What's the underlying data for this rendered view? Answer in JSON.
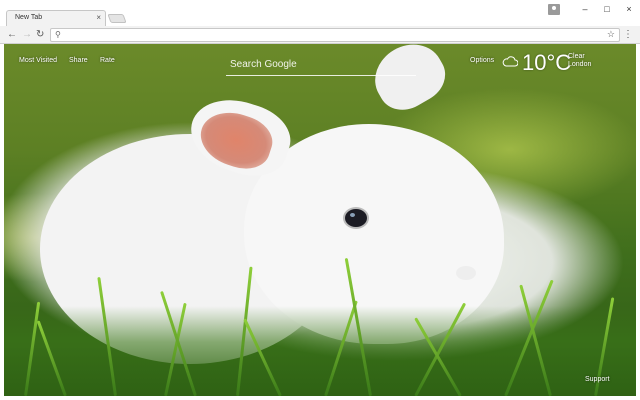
{
  "browser": {
    "tab_title": "New Tab",
    "tab_close": "×",
    "omnibox_value": "",
    "controls": {
      "minimize": "–",
      "maximize": "□",
      "close": "×"
    }
  },
  "page": {
    "nav": {
      "most_visited": "Most Visited",
      "share": "Share",
      "rate": "Rate"
    },
    "search": {
      "placeholder": "Search Google"
    },
    "options": "Options",
    "weather": {
      "temperature": "10°C",
      "condition": "Clear",
      "location": "London",
      "icon": "cloud-icon"
    },
    "support": "Support"
  }
}
